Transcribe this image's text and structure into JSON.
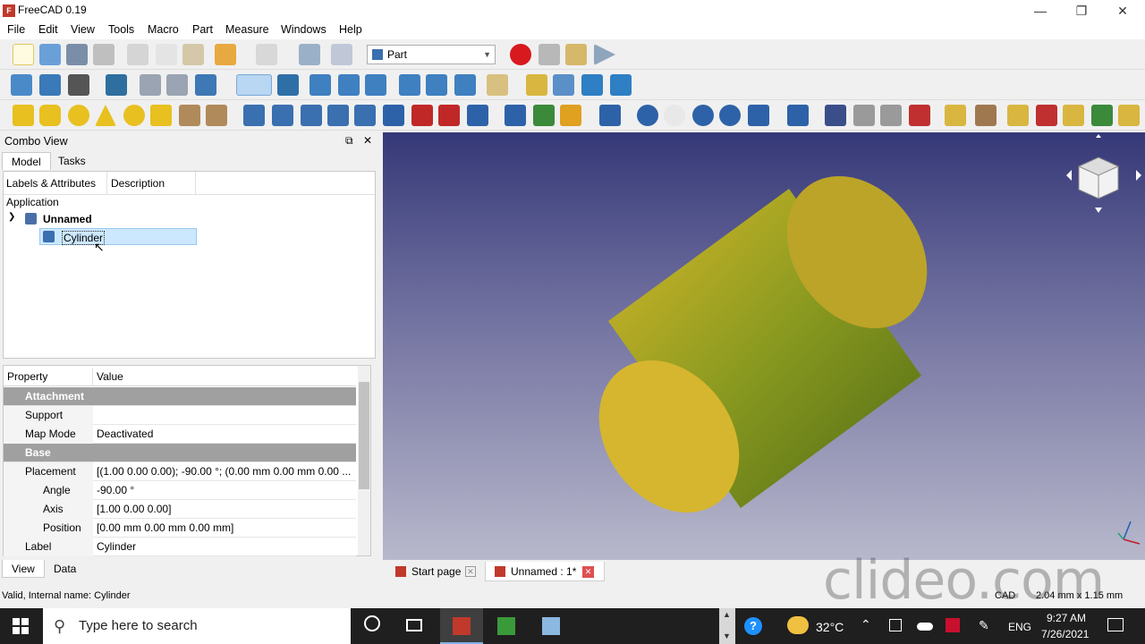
{
  "window": {
    "title": "FreeCAD 0.19"
  },
  "menu": [
    "File",
    "Edit",
    "View",
    "Tools",
    "Macro",
    "Part",
    "Measure",
    "Windows",
    "Help"
  ],
  "workbench": {
    "selected": "Part"
  },
  "combo": {
    "title": "Combo View",
    "tabs": {
      "model": "Model",
      "tasks": "Tasks"
    },
    "tree": {
      "col_labels": "Labels & Attributes",
      "col_description": "Description",
      "application": "Application",
      "document": "Unnamed",
      "item": "Cylinder"
    },
    "props": {
      "col_property": "Property",
      "col_value": "Value",
      "group_attachment": "Attachment",
      "support_k": "Support",
      "support_v": "",
      "mapmode_k": "Map Mode",
      "mapmode_v": "Deactivated",
      "group_base": "Base",
      "placement_k": "Placement",
      "placement_v": "[(1.00 0.00 0.00); -90.00 °; (0.00 mm  0.00 mm  0.00 ...",
      "angle_k": "Angle",
      "angle_v": "-90.00 °",
      "axis_k": "Axis",
      "axis_v": "[1.00 0.00 0.00]",
      "position_k": "Position",
      "position_v": "[0.00 mm  0.00 mm  0.00 mm]",
      "label_k": "Label",
      "label_v": "Cylinder"
    },
    "bottom_tabs": {
      "view": "View",
      "data": "Data"
    }
  },
  "doc_tabs": {
    "start": "Start page",
    "unnamed": "Unnamed : 1*"
  },
  "status": {
    "message": "Valid, Internal name: Cylinder",
    "nav": "CAD",
    "dimensions": "2.04 mm x 1.15 mm"
  },
  "watermark": "clideo.com",
  "taskbar": {
    "search_placeholder": "Type here to search",
    "temperature": "32°C",
    "lang": "ENG",
    "time": "9:27 AM",
    "date": "7/26/2021"
  },
  "colors": {
    "accent": "#c8102e",
    "selection": "#cce8ff",
    "cylinder": "#c8a828"
  }
}
